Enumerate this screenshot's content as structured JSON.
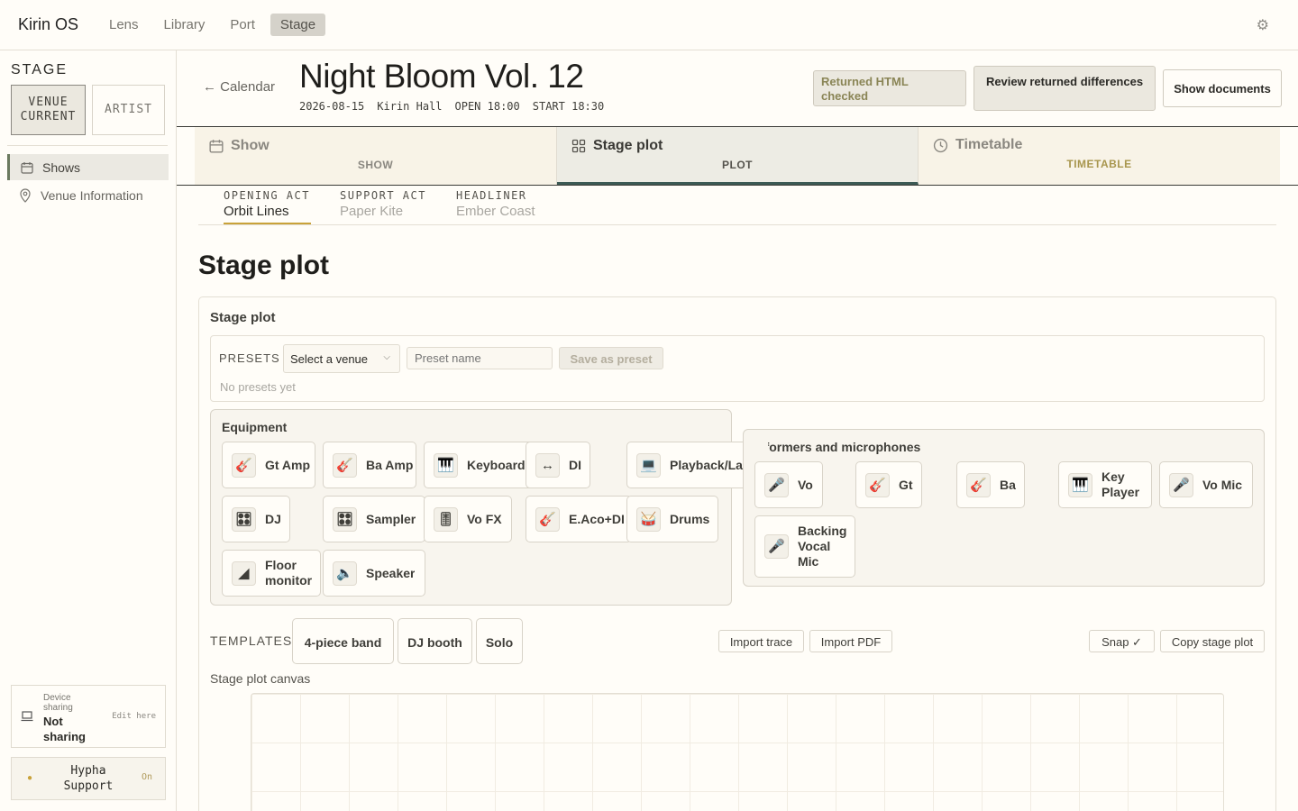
{
  "app": {
    "name": "Kirin OS",
    "nav": [
      "Lens",
      "Library",
      "Port",
      "Stage"
    ],
    "active_nav": "Stage",
    "settings_icon": "gear-icon"
  },
  "sidebar": {
    "title": "STAGE",
    "modes": [
      {
        "label": "VENUE\nCURRENT",
        "active": true
      },
      {
        "label": "ARTIST",
        "active": false
      }
    ],
    "items": [
      {
        "label": "Shows",
        "icon": "calendar-icon",
        "active": true
      },
      {
        "label": "Venue Information",
        "icon": "location-pin-icon",
        "active": false
      }
    ],
    "device": {
      "label": "Device sharing",
      "status": "Not sharing",
      "edit": "Edit here"
    },
    "support": {
      "label": "Hypha Support",
      "state": "On"
    }
  },
  "header": {
    "back": "← Calendar",
    "title": "Night Bloom Vol. 12",
    "meta": [
      "2026-08-15",
      "Kirin Hall",
      "OPEN 18:00",
      "START 18:30"
    ],
    "buttons": {
      "returned": "Returned HTML checked",
      "review": "Review returned differences",
      "docs": "Show documents"
    }
  },
  "tabs": [
    {
      "title": "Show",
      "sub": "SHOW",
      "icon": "calendar-icon"
    },
    {
      "title": "Stage plot",
      "sub": "PLOT",
      "icon": "grid-icon",
      "active": true
    },
    {
      "title": "Timetable",
      "sub": "TIMETABLE",
      "icon": "clock-icon"
    }
  ],
  "acts": [
    {
      "role": "OPENING ACT",
      "name": "Orbit Lines",
      "active": true
    },
    {
      "role": "SUPPORT ACT",
      "name": "Paper Kite"
    },
    {
      "role": "HEADLINER",
      "name": "Ember Coast"
    }
  ],
  "section_title": "Stage plot",
  "card": {
    "title": "Stage plot",
    "presets": {
      "label": "PRESETS",
      "venue_select": "Select a venue",
      "name_placeholder": "Preset name",
      "save": "Save as preset",
      "empty": "No presets yet"
    },
    "equipment": {
      "title": "Equipment",
      "items": [
        {
          "label": "Gt Amp",
          "icon": "guitar-icon",
          "glyph": "🎸"
        },
        {
          "label": "Ba Amp",
          "icon": "guitar-icon",
          "glyph": "🎸"
        },
        {
          "label": "Keyboard",
          "icon": "keyboard-icon",
          "glyph": "🎹"
        },
        {
          "label": "DI",
          "icon": "arrows-icon",
          "glyph": "↔"
        },
        {
          "label": "Playback/Laptop",
          "icon": "laptop-icon",
          "glyph": "💻"
        },
        {
          "label": "DJ",
          "icon": "mixer-icon",
          "glyph": "🎛"
        },
        {
          "label": "Sampler",
          "icon": "mixer-icon",
          "glyph": "🎛"
        },
        {
          "label": "Vo FX",
          "icon": "fader-icon",
          "glyph": "🎚"
        },
        {
          "label": "E.Aco+DI",
          "icon": "guitar-icon",
          "glyph": "🎸"
        },
        {
          "label": "Drums",
          "icon": "drum-icon",
          "glyph": "🥁"
        },
        {
          "label": "Floor monitor",
          "icon": "wedge-icon",
          "glyph": "◢"
        },
        {
          "label": "Speaker",
          "icon": "speaker-icon",
          "glyph": "🔈"
        }
      ]
    },
    "performers": {
      "title": "Performers and microphones",
      "items": [
        {
          "label": "Vo",
          "icon": "microphone-icon",
          "glyph": "🎤"
        },
        {
          "label": "Gt",
          "icon": "guitar-icon",
          "glyph": "🎸"
        },
        {
          "label": "Ba",
          "icon": "guitar-icon",
          "glyph": "🎸"
        },
        {
          "label": "Key Player",
          "icon": "keyboard-icon",
          "glyph": "🎹"
        },
        {
          "label": "Vo Mic",
          "icon": "microphone-icon",
          "glyph": "🎤"
        },
        {
          "label": "Backing Vocal Mic",
          "icon": "microphone-icon",
          "glyph": "🎤"
        }
      ]
    },
    "templates": {
      "label": "TEMPLATES",
      "items": [
        "4-piece band",
        "DJ booth",
        "Solo"
      ]
    },
    "actions": {
      "import_trace": "Import trace",
      "import_pdf": "Import PDF",
      "snap": "Snap ✓",
      "copy": "Copy stage plot"
    },
    "canvas_label": "Stage plot canvas"
  }
}
